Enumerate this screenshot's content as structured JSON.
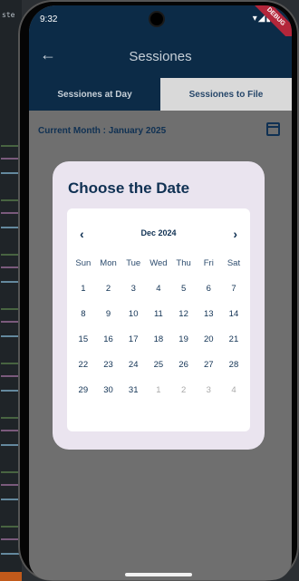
{
  "editor": {
    "tag": "ste"
  },
  "status": {
    "time": "9:32",
    "icons": "▾◢▮",
    "debug": "DEBUG"
  },
  "appbar": {
    "back": "←",
    "title": "Sessiones"
  },
  "tabs": [
    {
      "label": "Sessiones at Day"
    },
    {
      "label": "Sessiones to File"
    }
  ],
  "month": {
    "label": "Current Month : January 2025"
  },
  "dialog": {
    "title": "Choose the Date",
    "nav": {
      "prev": "‹",
      "label": "Dec 2024",
      "next": "›"
    },
    "weekdays": [
      "Sun",
      "Mon",
      "Tue",
      "Wed",
      "Thu",
      "Fri",
      "Sat"
    ],
    "weeks": [
      [
        "1",
        "2",
        "3",
        "4",
        "5",
        "6",
        "7"
      ],
      [
        "8",
        "9",
        "10",
        "11",
        "12",
        "13",
        "14"
      ],
      [
        "15",
        "16",
        "17",
        "18",
        "19",
        "20",
        "21"
      ],
      [
        "22",
        "23",
        "24",
        "25",
        "26",
        "27",
        "28"
      ],
      [
        "29",
        "30",
        "31",
        "1",
        "2",
        "3",
        "4"
      ]
    ],
    "dimmed_from_index_in_last_week": 3
  },
  "colors": {
    "navy": "#0c2b47",
    "text_navy": "#103153",
    "overlay": "#6f6f6f",
    "dialog_bg": "#eae4ef",
    "debug_banner": "#b3263a"
  }
}
